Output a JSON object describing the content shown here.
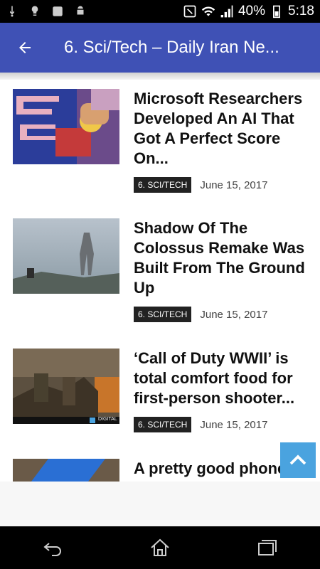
{
  "status_bar": {
    "battery": "40%",
    "time": "5:18"
  },
  "app_bar": {
    "title": "6. Sci/Tech – Daily Iran Ne..."
  },
  "articles": [
    {
      "headline": "Microsoft Researchers Developed An AI That Got A Perfect Score On...",
      "category": "6. SCI/TECH",
      "date": "June 15, 2017",
      "thumbnail": "pacman-arcade-image"
    },
    {
      "headline": "Shadow Of The Colossus Remake Was Built From The Ground Up",
      "category": "6. SCI/TECH",
      "date": "June 15, 2017",
      "thumbnail": "colossus-landscape-image"
    },
    {
      "headline": "‘Call of Duty WWII’ is total comfort food for first-person shooter...",
      "category": "6. SCI/TECH",
      "date": "June 15, 2017",
      "thumbnail": "soldiers-battlefield-image",
      "thumb_caption": "DIGITAL"
    },
    {
      "headline": "A pretty good phone",
      "thumbnail": "blue-device-image"
    }
  ],
  "icons": {
    "back": "arrow-back-icon",
    "scroll_top": "chevron-up-icon",
    "nav": [
      "back-nav-icon",
      "home-icon",
      "recents-icon"
    ]
  },
  "colors": {
    "app_bar": "#3f51b5",
    "tag_bg": "#222222",
    "scroll_top_bg": "#4aa3df"
  }
}
